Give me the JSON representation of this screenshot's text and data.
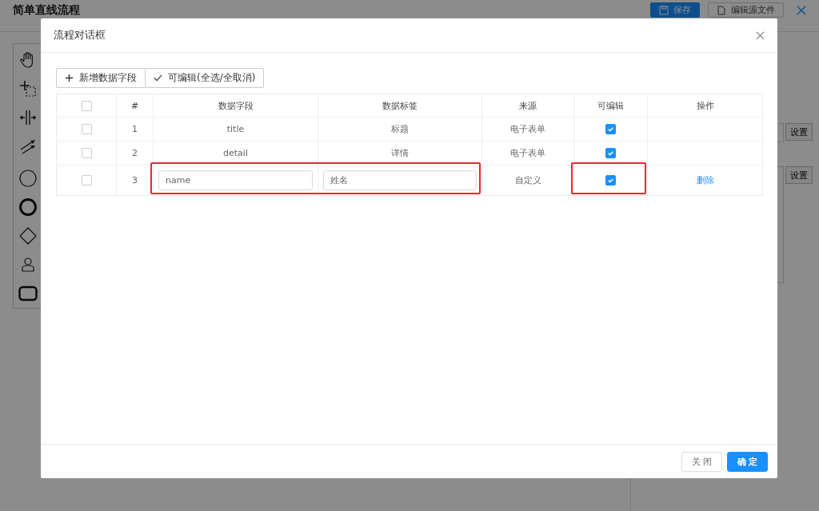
{
  "page": {
    "title": "简单直线流程",
    "buttons": [
      {
        "kind": "primary",
        "label": "保存"
      },
      {
        "kind": "default",
        "label": "编辑源文件"
      }
    ],
    "panel_buttons": [
      "设置",
      "设置"
    ]
  },
  "dialog": {
    "title": "流程对话框",
    "toolbar": [
      {
        "kind": "add",
        "label": "新增数据字段"
      },
      {
        "kind": "check",
        "label": "可编辑(全选/全取消)"
      }
    ],
    "table": {
      "select_all_checked": false,
      "columns": [
        "#",
        "数据字段",
        "数据标签",
        "来源",
        "可编辑",
        "操作"
      ],
      "rows": [
        {
          "checked": false,
          "index": "1",
          "kind": "text",
          "field": "title",
          "label": "标题",
          "source": "电子表单",
          "editable": true,
          "highlighted": false
        },
        {
          "checked": false,
          "index": "2",
          "kind": "text",
          "field": "detail",
          "label": "详情",
          "source": "电子表单",
          "editable": true,
          "highlighted": false
        },
        {
          "checked": false,
          "index": "3",
          "kind": "input",
          "field": "name",
          "label": "姓名",
          "source": "自定义",
          "editable": true,
          "action": "删除",
          "highlighted": true
        }
      ]
    },
    "footer": [
      {
        "kind": "default",
        "label": "关 闭"
      },
      {
        "kind": "primary",
        "label": "确 定"
      }
    ]
  }
}
